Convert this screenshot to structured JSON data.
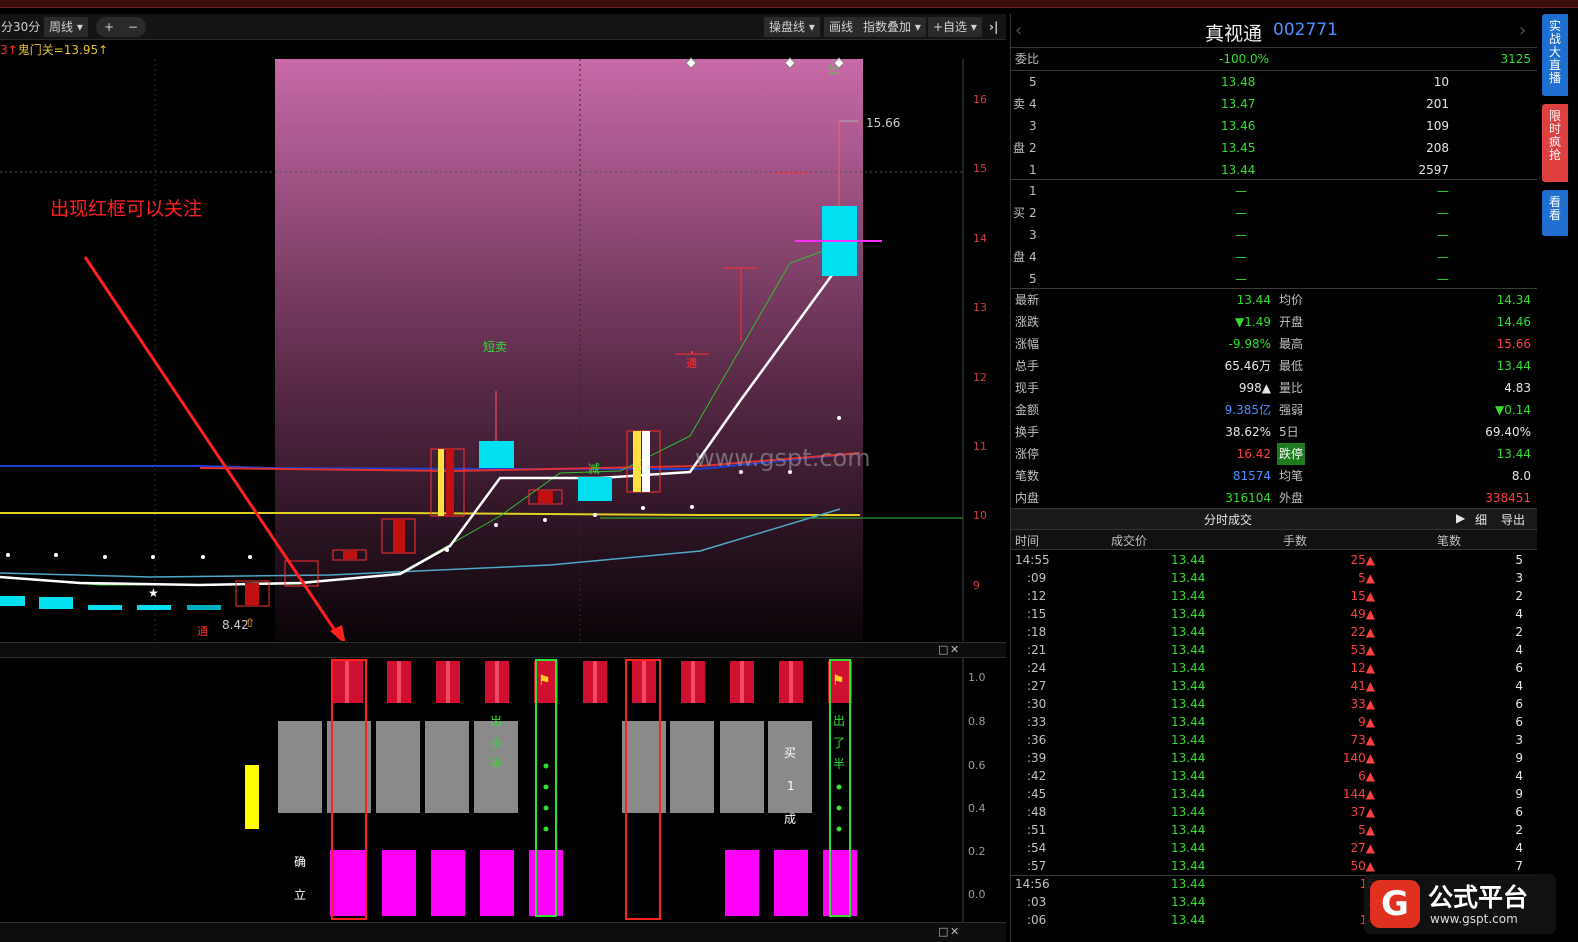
{
  "toolbar": {
    "left_partial": "分",
    "period": "30分",
    "week": "周线",
    "zoom_in": "+",
    "zoom_out": "−",
    "draw_line": "操盘线",
    "paint": "画线",
    "index_overlay": "指数叠加",
    "watchlist": "+自选",
    "collapse": "›|"
  },
  "indicator": {
    "prefix": "3↑",
    "text": "鬼门关=13.95↑"
  },
  "annotation": {
    "text": "出现红框可以关注"
  },
  "watermark": "www.gspt.com",
  "main_chart": {
    "price_labels": [
      "16",
      "15",
      "14",
      "13",
      "12",
      "11",
      "10",
      "9"
    ],
    "high_label": "15.66",
    "low_label": "8.42",
    "signal_short_sell": "短卖",
    "signal_reduce": "减",
    "signal_mark": "通",
    "signal_low": "通",
    "signal_top": "出"
  },
  "sub_chart": {
    "axis_labels": [
      "1.0",
      "0.8",
      "0.6",
      "0.4",
      "0.2",
      "0.0"
    ],
    "text_chu_xiao_ban": [
      "出",
      "小",
      "半"
    ],
    "text_chu_xiao_ban_2": [
      "出",
      "了",
      "半"
    ],
    "text_mai_yi_cheng": [
      "买",
      "1",
      "成"
    ],
    "text_que_li": [
      "确",
      "立"
    ]
  },
  "colors": {
    "accent_red": "#ff3030",
    "green": "#33dd33",
    "magenta": "#ff00ff",
    "cyan": "#00e0f0",
    "blue": "#4f8fff",
    "gray_block": "#8a8a8a"
  },
  "quote": {
    "name": "真视通",
    "code": "002771",
    "weibi_label": "委比",
    "weibi_value": "-100.0%",
    "weibi_diff": "3125",
    "sell_label": [
      "卖",
      "盘"
    ],
    "buy_label": [
      "买",
      "盘"
    ],
    "sell": [
      {
        "level": "5",
        "price": "13.48",
        "vol": "10"
      },
      {
        "level": "4",
        "price": "13.47",
        "vol": "201"
      },
      {
        "level": "3",
        "price": "13.46",
        "vol": "109"
      },
      {
        "level": "2",
        "price": "13.45",
        "vol": "208"
      },
      {
        "level": "1",
        "price": "13.44",
        "vol": "2597"
      }
    ],
    "buy": [
      {
        "level": "1",
        "price": "—",
        "vol": "—"
      },
      {
        "level": "2",
        "price": "—",
        "vol": "—"
      },
      {
        "level": "3",
        "price": "—",
        "vol": "—"
      },
      {
        "level": "4",
        "price": "—",
        "vol": "—"
      },
      {
        "level": "5",
        "price": "—",
        "vol": "—"
      }
    ],
    "stats": [
      {
        "l1": "最新",
        "v1": "13.44",
        "c1": "grn",
        "l2": "均价",
        "v2": "14.34",
        "c2": "grn"
      },
      {
        "l1": "涨跌",
        "v1": "▼1.49",
        "c1": "grn",
        "l2": "开盘",
        "v2": "14.46",
        "c2": "grn"
      },
      {
        "l1": "涨幅",
        "v1": "-9.98%",
        "c1": "grn",
        "l2": "最高",
        "v2": "15.66",
        "c2": "redc"
      },
      {
        "l1": "总手",
        "v1": "65.46万",
        "c1": "wht",
        "l2": "最低",
        "v2": "13.44",
        "c2": "grn"
      },
      {
        "l1": "现手",
        "v1": "998▲",
        "c1": "wht",
        "l2": "量比",
        "v2": "4.83",
        "c2": "wht"
      },
      {
        "l1": "金额",
        "v1": "9.385亿",
        "c1": "blu",
        "l2": "强弱",
        "v2": "▼0.14",
        "c2": "grn"
      },
      {
        "l1": "换手",
        "v1": "38.62%",
        "c1": "wht",
        "l2": "5日",
        "v2": "69.40%",
        "c2": "wht"
      },
      {
        "l1": "涨停",
        "v1": "16.42",
        "c1": "redc",
        "l2": "跌停",
        "v2": "13.44",
        "c2": "grn"
      },
      {
        "l1": "笔数",
        "v1": "81574",
        "c1": "blu",
        "l2": "均笔",
        "v2": "8.0",
        "c2": "wht"
      },
      {
        "l1": "内盘",
        "v1": "316104",
        "c1": "grn",
        "l2": "外盘",
        "v2": "338451",
        "c2": "redc"
      }
    ],
    "trades_title": "分时成交",
    "trades_detail": "细",
    "trades_export": "导出",
    "trades_cols": [
      "时间",
      "成交价",
      "手数",
      "笔数"
    ],
    "trades": [
      {
        "t": "14:55",
        "p": "13.44",
        "v": "25▲",
        "n": "5"
      },
      {
        "t": ":09",
        "p": "13.44",
        "v": "5▲",
        "n": "3"
      },
      {
        "t": ":12",
        "p": "13.44",
        "v": "15▲",
        "n": "2"
      },
      {
        "t": ":15",
        "p": "13.44",
        "v": "49▲",
        "n": "4"
      },
      {
        "t": ":18",
        "p": "13.44",
        "v": "22▲",
        "n": "2"
      },
      {
        "t": ":21",
        "p": "13.44",
        "v": "53▲",
        "n": "4"
      },
      {
        "t": ":24",
        "p": "13.44",
        "v": "12▲",
        "n": "6"
      },
      {
        "t": ":27",
        "p": "13.44",
        "v": "41▲",
        "n": "4"
      },
      {
        "t": ":30",
        "p": "13.44",
        "v": "33▲",
        "n": "6"
      },
      {
        "t": ":33",
        "p": "13.44",
        "v": "9▲",
        "n": "6"
      },
      {
        "t": ":36",
        "p": "13.44",
        "v": "73▲",
        "n": "3"
      },
      {
        "t": ":39",
        "p": "13.44",
        "v": "140▲",
        "n": "9"
      },
      {
        "t": ":42",
        "p": "13.44",
        "v": "6▲",
        "n": "4"
      },
      {
        "t": ":45",
        "p": "13.44",
        "v": "144▲",
        "n": "9"
      },
      {
        "t": ":48",
        "p": "13.44",
        "v": "37▲",
        "n": "6"
      },
      {
        "t": ":51",
        "p": "13.44",
        "v": "5▲",
        "n": "2"
      },
      {
        "t": ":54",
        "p": "13.44",
        "v": "27▲",
        "n": "4"
      },
      {
        "t": ":57",
        "p": "13.44",
        "v": "50▲",
        "n": "7"
      },
      {
        "t": "14:56",
        "p": "13.44",
        "v": "15",
        "n": ""
      },
      {
        "t": ":03",
        "p": "13.44",
        "v": "2",
        "n": ""
      },
      {
        "t": ":06",
        "p": "13.44",
        "v": "14",
        "n": ""
      }
    ]
  },
  "side_tabs": [
    {
      "text": "实战大直播",
      "color": "#1e6fd0"
    },
    {
      "text": "限时疯抢",
      "color": "#e04040"
    },
    {
      "text": "看看",
      "color": "#1e6fd0"
    }
  ],
  "logo": {
    "mark": "G",
    "text": "公式平台",
    "url_text": "www.gspt.com"
  }
}
